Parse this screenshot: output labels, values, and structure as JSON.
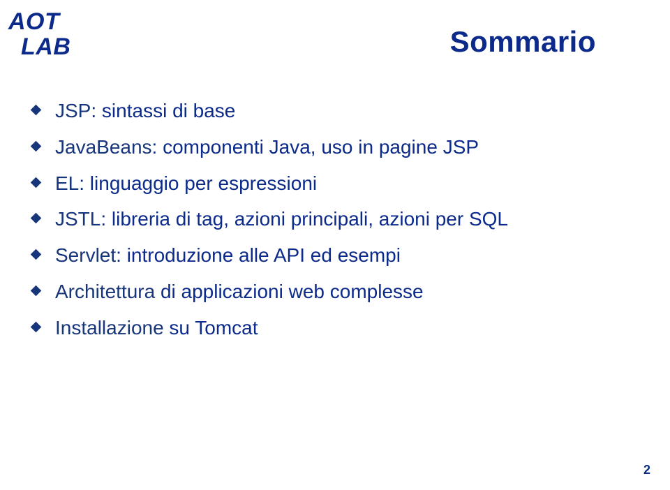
{
  "logo": {
    "line1": "AOT",
    "line2": "LAB"
  },
  "title": "Sommario",
  "bullets": [
    {
      "lead": "JSP",
      "rest": ": sintassi di base"
    },
    {
      "lead": "JavaBeans",
      "rest": ": componenti Java, uso in pagine JSP"
    },
    {
      "lead": "EL",
      "rest": ": linguaggio per espressioni"
    },
    {
      "lead": "JSTL",
      "rest": ": libreria di tag, azioni principali, azioni per SQL"
    },
    {
      "lead": "Servlet",
      "rest": ": introduzione alle API ed esempi"
    },
    {
      "lead": "Architettura",
      "rest": " di applicazioni web complesse"
    },
    {
      "lead": "Installazione",
      "rest": " su Tomcat"
    }
  ],
  "pageNumber": "2"
}
